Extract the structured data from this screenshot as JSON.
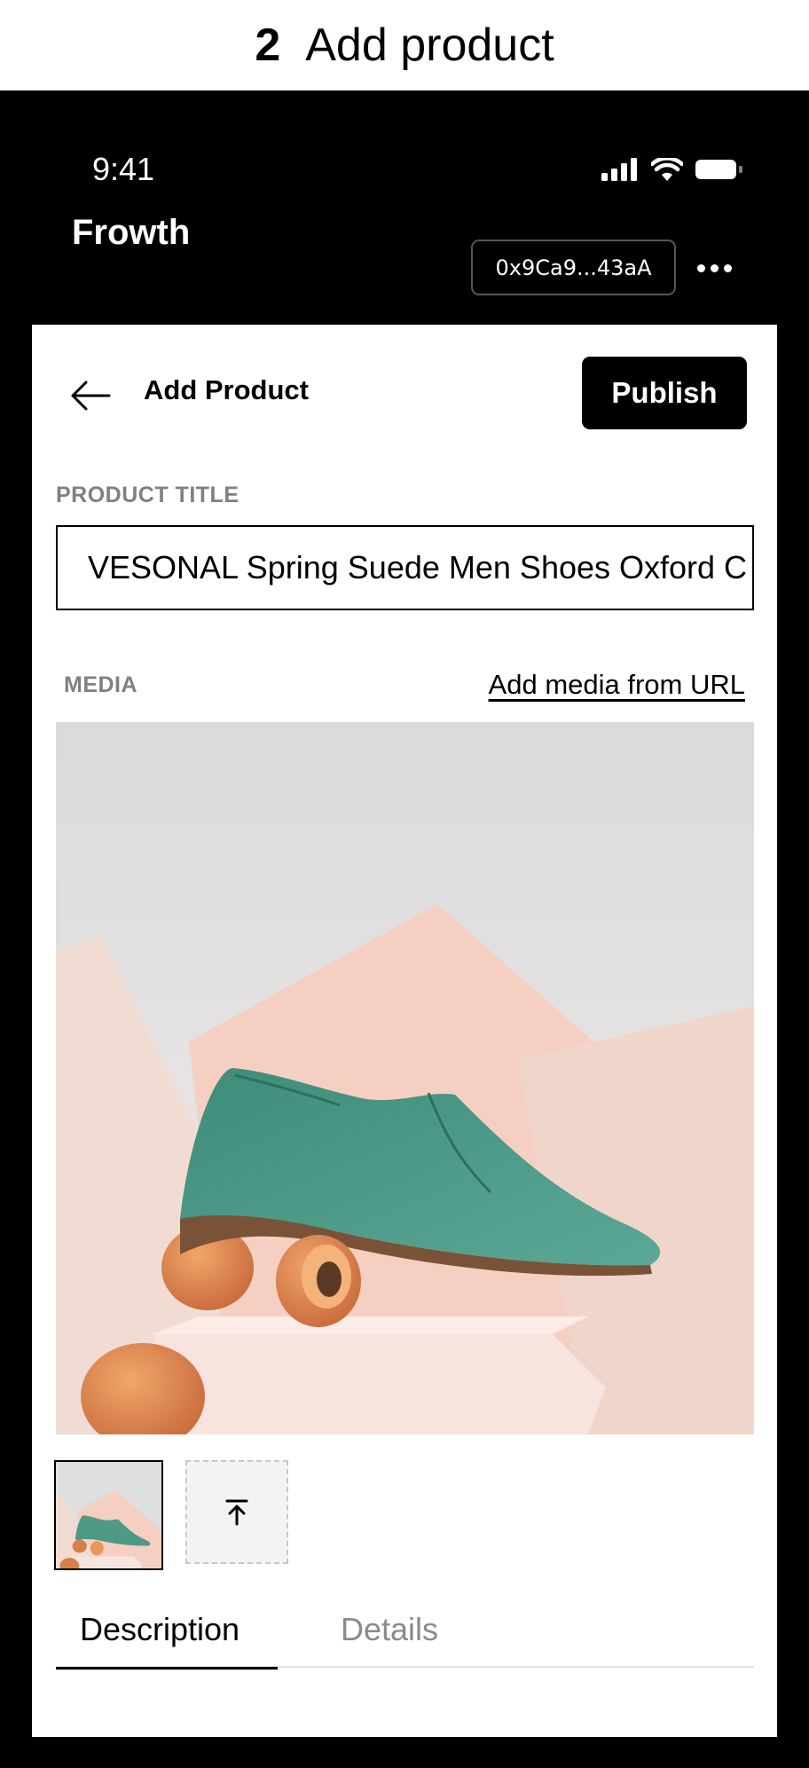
{
  "step": {
    "number": "2",
    "title": "Add product"
  },
  "status_bar": {
    "time": "9:41",
    "icons": [
      "signal-icon",
      "wifi-icon",
      "battery-icon"
    ]
  },
  "app": {
    "brand": "Frowth",
    "wallet": "0x9Ca9...43aA",
    "more_icon": "more-horizontal-icon"
  },
  "page": {
    "title": "Add Product",
    "back_icon": "arrow-left-icon",
    "publish_label": "Publish"
  },
  "form": {
    "product_title_label": "PRODUCT TITLE",
    "product_title_value": "VESONAL Spring Suede Men Shoes Oxford C",
    "media_label": "MEDIA",
    "add_media_link": "Add media from URL",
    "upload_icon": "upload-icon"
  },
  "tabs": [
    {
      "label": "Description",
      "active": true
    },
    {
      "label": "Details",
      "active": false
    }
  ],
  "colors": {
    "device_frame": "#000000",
    "accent": "#000000",
    "muted_label": "#808080",
    "shoe": "#4f9a86"
  }
}
